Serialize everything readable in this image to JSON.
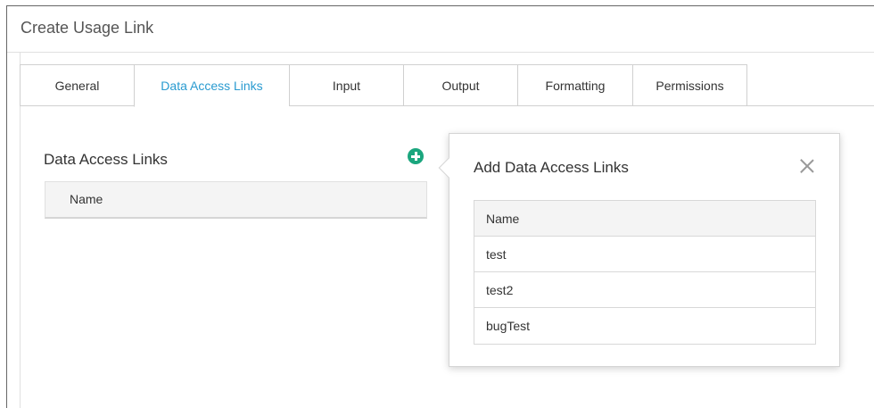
{
  "dialog": {
    "title": "Create Usage Link"
  },
  "tabs": [
    {
      "label": "General",
      "active": false
    },
    {
      "label": "Data Access Links",
      "active": true
    },
    {
      "label": "Input",
      "active": false
    },
    {
      "label": "Output",
      "active": false
    },
    {
      "label": "Formatting",
      "active": false
    },
    {
      "label": "Permissions",
      "active": false
    }
  ],
  "section": {
    "title": "Data Access Links",
    "add_icon": "plus-circle-icon",
    "table": {
      "header": "Name"
    }
  },
  "popover": {
    "title": "Add Data Access Links",
    "close_icon": "close-icon",
    "table": {
      "header": "Name",
      "rows": [
        "test",
        "test2",
        "bugTest"
      ]
    }
  },
  "colors": {
    "accent": "#2a9bd0",
    "add_button": "#1ba67e",
    "header_bg": "#f4f4f4",
    "border": "#d8d8d8"
  }
}
